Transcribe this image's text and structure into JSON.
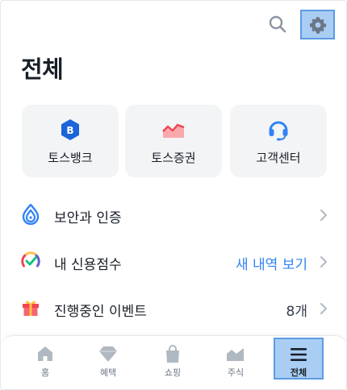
{
  "page": {
    "title": "전체"
  },
  "header": {
    "search_icon": "search-icon",
    "settings_icon": "gear-icon"
  },
  "tiles": [
    {
      "label": "토스뱅크",
      "icon": "toss-bank-logo-icon"
    },
    {
      "label": "토스증권",
      "icon": "stock-chart-icon"
    },
    {
      "label": "고객센터",
      "icon": "headset-icon"
    }
  ],
  "list": [
    {
      "label": "보안과 인증",
      "value": "",
      "icon": "security-drop-icon"
    },
    {
      "label": "내 신용점수",
      "value": "새 내역 보기",
      "icon": "credit-gauge-icon"
    },
    {
      "label": "진행중인 이벤트",
      "value": "8개",
      "icon": "gift-icon"
    }
  ],
  "nav": [
    {
      "label": "홈",
      "icon": "home-icon"
    },
    {
      "label": "혜택",
      "icon": "diamond-icon"
    },
    {
      "label": "쇼핑",
      "icon": "shopping-bag-icon"
    },
    {
      "label": "주식",
      "icon": "stock-icon"
    },
    {
      "label": "전체",
      "icon": "menu-icon",
      "active": true
    }
  ],
  "colors": {
    "accent": "#3182f6",
    "highlight": "#a9cdf3",
    "tile_bg": "#f2f4f6",
    "text": "#191f28",
    "muted": "#6b7684"
  }
}
